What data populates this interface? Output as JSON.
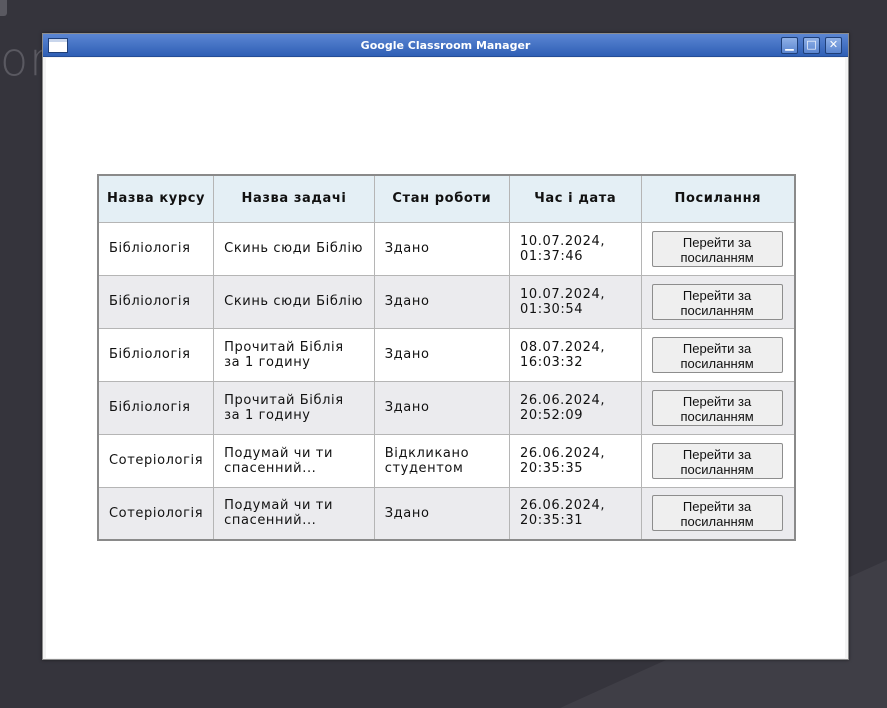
{
  "desktop": {
    "fragment_text": "or"
  },
  "window": {
    "title": "Google Classroom Manager",
    "buttons": {
      "minimize": "▁",
      "maximize": "□",
      "close": "✕"
    }
  },
  "table": {
    "headers": {
      "course": "Назва курсу",
      "task": "Назва задачі",
      "status": "Стан роботи",
      "datetime": "Час і дата",
      "link": "Посилання"
    },
    "rows": [
      {
        "course": "Бібліологія",
        "task": "Скинь сюди Біблію",
        "status": "Здано",
        "datetime": "10.07.2024, 01:37:46",
        "link_label": "Перейти за посиланням"
      },
      {
        "course": "Бібліологія",
        "task": "Скинь сюди Біблію",
        "status": "Здано",
        "datetime": "10.07.2024, 01:30:54",
        "link_label": "Перейти за посиланням"
      },
      {
        "course": "Бібліологія",
        "task": "Прочитай Біблія за 1 годину",
        "status": "Здано",
        "datetime": "08.07.2024, 16:03:32",
        "link_label": "Перейти за посиланням"
      },
      {
        "course": "Бібліологія",
        "task": "Прочитай Біблія за 1 годину",
        "status": "Здано",
        "datetime": "26.06.2024, 20:52:09",
        "link_label": "Перейти за посиланням"
      },
      {
        "course": "Сотеріологія",
        "task": "Подумай чи ти спасенний...",
        "status": "Відкликано студентом",
        "datetime": "26.06.2024, 20:35:35",
        "link_label": "Перейти за посиланням"
      },
      {
        "course": "Сотеріологія",
        "task": "Подумай чи ти спасенний...",
        "status": "Здано",
        "datetime": "26.06.2024, 20:35:31",
        "link_label": "Перейти за посиланням"
      }
    ]
  }
}
